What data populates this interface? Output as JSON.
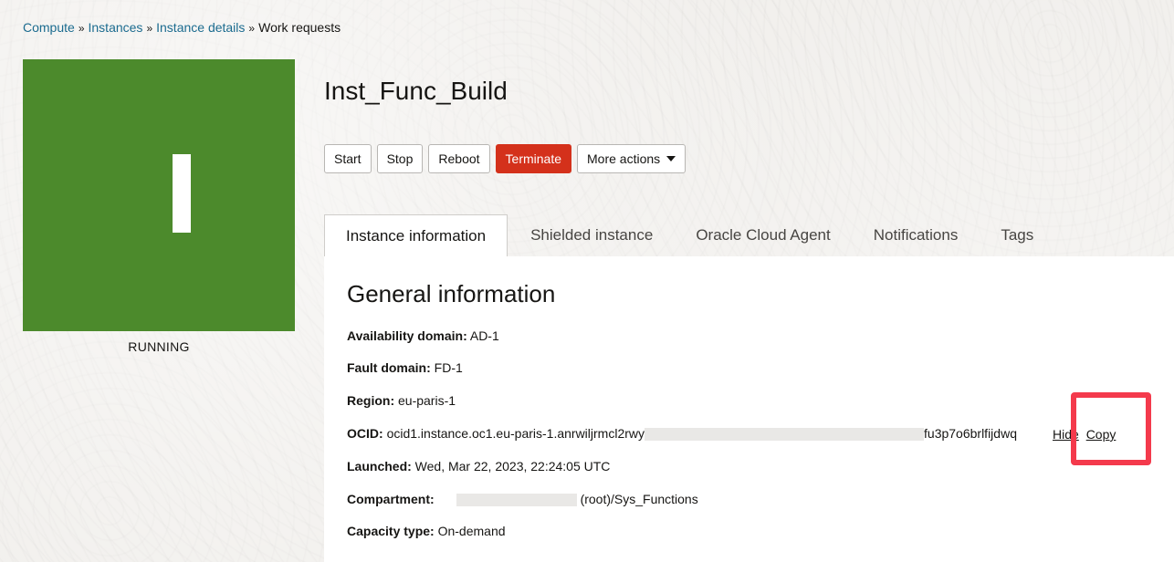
{
  "breadcrumb": {
    "items": [
      "Compute",
      "Instances",
      "Instance details"
    ],
    "current": "Work requests",
    "separator": "»"
  },
  "instance": {
    "name": "Inst_Func_Build",
    "status": "RUNNING",
    "status_color": "#4c8a2c"
  },
  "actions": {
    "start": "Start",
    "stop": "Stop",
    "reboot": "Reboot",
    "terminate": "Terminate",
    "more": "More actions"
  },
  "tabs": [
    {
      "label": "Instance information",
      "active": true
    },
    {
      "label": "Shielded instance",
      "active": false
    },
    {
      "label": "Oracle Cloud Agent",
      "active": false
    },
    {
      "label": "Notifications",
      "active": false
    },
    {
      "label": "Tags",
      "active": false
    }
  ],
  "general": {
    "title": "General information",
    "availability_domain": {
      "label": "Availability domain:",
      "value": "AD-1"
    },
    "fault_domain": {
      "label": "Fault domain:",
      "value": "FD-1"
    },
    "region": {
      "label": "Region:",
      "value": "eu-paris-1"
    },
    "ocid": {
      "label": "OCID:",
      "value_start": "ocid1.instance.oc1.eu-paris-1.anrwiljrmcl2rwy",
      "value_end": "fu3p7o6brlfijdwq",
      "hide_label": "Hide",
      "copy_label": "Copy"
    },
    "launched": {
      "label": "Launched:",
      "value": "Wed, Mar 22, 2023, 22:24:05 UTC"
    },
    "compartment": {
      "label": "Compartment:",
      "value": "(root)/Sys_Functions"
    },
    "capacity_type": {
      "label": "Capacity type:",
      "value": "On-demand"
    }
  },
  "colors": {
    "link": "#1b6b8f",
    "terminate": "#d4311b",
    "highlight": "#f43a4c"
  }
}
